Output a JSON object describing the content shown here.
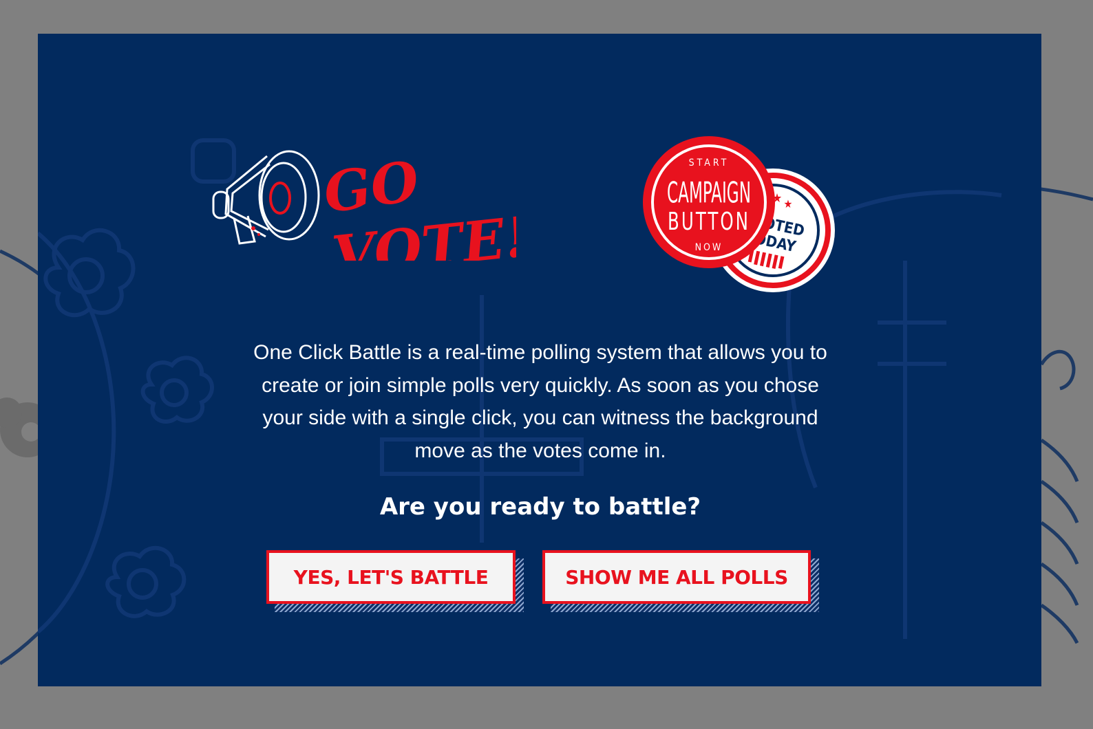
{
  "colors": {
    "overlay": "#808080",
    "modal_bg": "#022a5e",
    "accent_red": "#e8121e",
    "text": "#ffffff",
    "button_bg": "#f4f4f4"
  },
  "logo": {
    "go": "GO",
    "vote": "VOTE!"
  },
  "badges": {
    "campaign": {
      "top": "START",
      "line1": "CAMPAIGN",
      "line2": "BUTTON",
      "bottom": "NOW"
    },
    "voted": {
      "line1": "I VOTED",
      "line2": "TODAY"
    }
  },
  "intro": {
    "line1": "One Click Battle is a real-time polling system that allows you to",
    "line2": "create or join simple polls very quickly. As soon as you chose",
    "line3": "your side with a single click, you can witness the background",
    "line4": "move as the votes come in.",
    "question": "Are you ready to battle?"
  },
  "buttons": {
    "battle": "YES, LET'S BATTLE",
    "all_polls": "SHOW ME ALL POLLS"
  }
}
